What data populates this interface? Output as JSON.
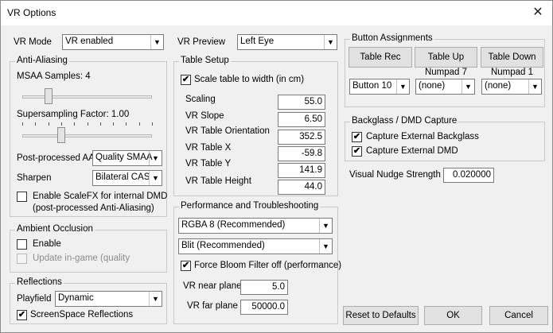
{
  "window": {
    "title": "VR Options",
    "close_glyph": "✕"
  },
  "vr_mode": {
    "label": "VR Mode",
    "value": "VR enabled"
  },
  "vr_preview": {
    "label": "VR Preview",
    "value": "Left Eye"
  },
  "anti_aliasing": {
    "legend": "Anti-Aliasing",
    "msaa_label": "MSAA Samples: 4",
    "msaa_level": 0.2,
    "supersampling_label": "Supersampling Factor: 1.00",
    "supersampling_level": 0.3,
    "postprocessed_label": "Post-processed AA",
    "postprocessed_value": "Quality SMAA",
    "sharpen_label": "Sharpen",
    "sharpen_value": "Bilateral CAS",
    "scalefx_label": "Enable ScaleFX for internal DMD",
    "scalefx_sublabel": "(post-processed Anti-Aliasing)"
  },
  "ambient_occlusion": {
    "legend": "Ambient Occlusion",
    "enable_label": "Enable",
    "update_label": "Update in-game (quality"
  },
  "reflections": {
    "legend": "Reflections",
    "playfield_label": "Playfield",
    "playfield_value": "Dynamic",
    "ssr_label": "ScreenSpace Reflections"
  },
  "table_setup": {
    "legend": "Table Setup",
    "scale_label": "Scale table to width (in cm)",
    "fields": [
      {
        "label": "Scaling",
        "value": "55.0"
      },
      {
        "label": "VR Slope",
        "value": "6.50"
      },
      {
        "label": "VR Table Orientation",
        "value": "352.5"
      },
      {
        "label": "VR Table X",
        "value": "-59.8"
      },
      {
        "label": "VR Table Y",
        "value": "141.9"
      },
      {
        "label": "VR Table Height",
        "value": "44.0"
      }
    ]
  },
  "performance": {
    "legend": "Performance and Troubleshooting",
    "format_value": "RGBA 8 (Recommended)",
    "blit_value": "Blit (Recommended)",
    "bloom_label": "Force Bloom Filter off (performance)",
    "near_label": "VR near plane",
    "near_value": "5.0",
    "far_label": "VR far plane",
    "far_value": "50000.0"
  },
  "button_assignments": {
    "legend": "Button Assignments",
    "table_rec": {
      "label": "Table Rec",
      "key": "",
      "value": "Button 10"
    },
    "table_up": {
      "label": "Table Up",
      "key": "Numpad 7",
      "value": "(none)"
    },
    "table_down": {
      "label": "Table Down",
      "key": "Numpad 1",
      "value": "(none)"
    }
  },
  "backglass": {
    "legend": "Backglass / DMD Capture",
    "capture_backglass_label": "Capture External Backglass",
    "capture_dmd_label": "Capture External DMD"
  },
  "nudge": {
    "label": "Visual Nudge Strength",
    "value": "0.020000"
  },
  "footer": {
    "reset_label": "Reset to Defaults",
    "ok_label": "OK",
    "cancel_label": "Cancel"
  },
  "check_glyph": "✔",
  "arrow_glyph": "▼"
}
